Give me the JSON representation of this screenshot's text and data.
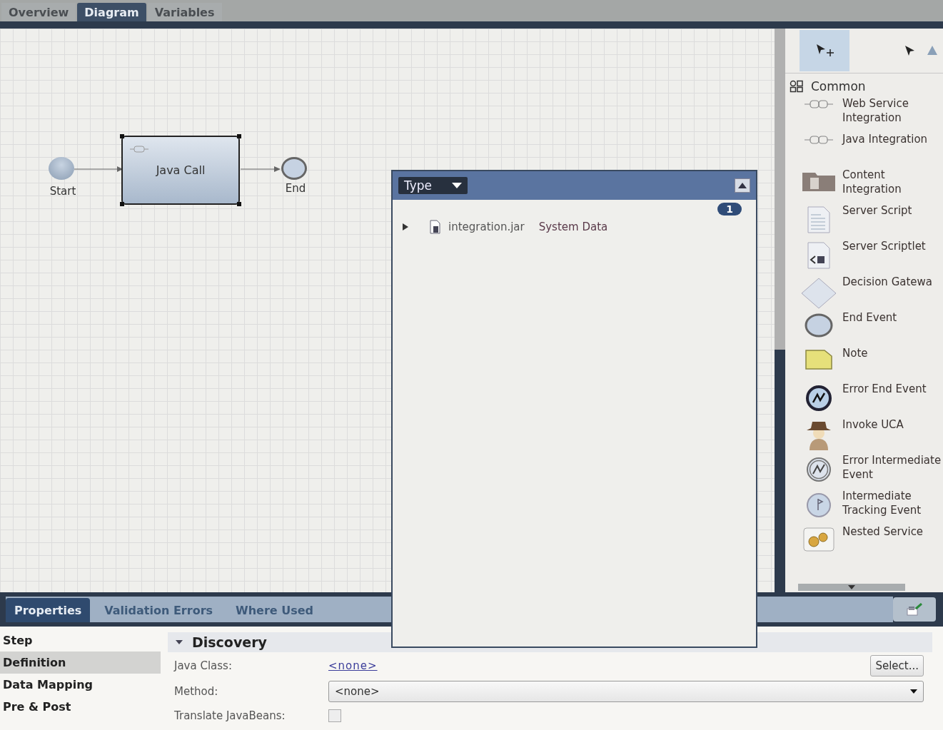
{
  "editor_tabs": [
    {
      "label": "Overview",
      "selected": false
    },
    {
      "label": "Diagram",
      "selected": true
    },
    {
      "label": "Variables",
      "selected": false
    }
  ],
  "diagram": {
    "nodes": [
      {
        "kind": "start",
        "label": "Start",
        "selected": false
      },
      {
        "kind": "task",
        "label": "Java Call",
        "selected": true
      },
      {
        "kind": "end",
        "label": "End",
        "selected": false
      }
    ]
  },
  "palette": {
    "section": "Common",
    "expanded": true,
    "items": [
      {
        "kind": "connector",
        "label": "Web Service Integration"
      },
      {
        "kind": "connector",
        "label": "Java Integration"
      },
      {
        "kind": "folder",
        "label": "Content Integration"
      },
      {
        "kind": "script",
        "label": "Server Script"
      },
      {
        "kind": "scriptlet",
        "label": "Server Scriptlet"
      },
      {
        "kind": "diamond",
        "label": "Decision Gatewa"
      },
      {
        "kind": "circle",
        "label": "End Event"
      },
      {
        "kind": "note",
        "label": "Note"
      },
      {
        "kind": "errorend",
        "label": "Error End Event"
      },
      {
        "kind": "person",
        "label": "Invoke UCA"
      },
      {
        "kind": "errorintermediate",
        "label": "Error Intermediate Event"
      },
      {
        "kind": "tracking",
        "label": "Intermediate Tracking Event"
      },
      {
        "kind": "gears",
        "label": "Nested Service"
      }
    ]
  },
  "popup": {
    "filter": "Type",
    "count": "1",
    "rows": [
      {
        "expanded": false,
        "name": "integration.jar",
        "type": "System Data"
      }
    ]
  },
  "properties": {
    "tabs": [
      {
        "label": "Properties",
        "selected": true
      },
      {
        "label": "Validation Errors",
        "selected": false
      },
      {
        "label": "Where Used",
        "selected": false
      }
    ],
    "nav": [
      {
        "label": "Step",
        "selected": false
      },
      {
        "label": "Definition",
        "selected": true
      },
      {
        "label": "Data Mapping",
        "selected": false
      },
      {
        "label": "Pre & Post",
        "selected": false
      }
    ],
    "section": {
      "title": "Discovery",
      "expanded": true
    },
    "java_class": {
      "label": "Java Class:",
      "value": "<none>",
      "button": "Select..."
    },
    "method": {
      "label": "Method:",
      "value": "<none>"
    },
    "translate": {
      "label": "Translate JavaBeans:",
      "checked": false
    }
  }
}
